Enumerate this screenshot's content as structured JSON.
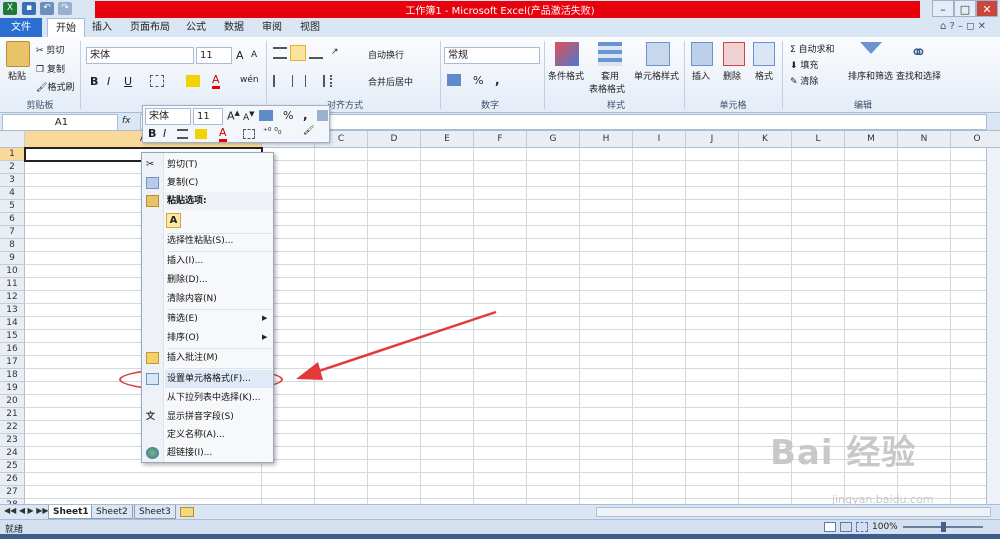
{
  "app": {
    "title": "工作簿1 - Microsoft Excel(产品激活失败)"
  },
  "tabs": {
    "file": "文件",
    "home": "开始",
    "insert": "插入",
    "page_layout": "页面布局",
    "formulas": "公式",
    "data": "数据",
    "review": "审阅",
    "view": "视图"
  },
  "ribbon": {
    "clipboard": {
      "label": "剪贴板",
      "paste": "粘贴",
      "cut": "剪切",
      "copy": "复制",
      "format_painter": "格式刷"
    },
    "font": {
      "label": "字体",
      "name": "宋体",
      "size": "11",
      "bold": "B",
      "italic": "I",
      "underline": "U",
      "grow": "A",
      "shrink": "A",
      "color_letter": "A",
      "phonetic": "wén"
    },
    "alignment": {
      "label": "对齐方式",
      "wrap_text": "自动换行",
      "merge_center": "合并后居中"
    },
    "number": {
      "label": "数字",
      "format": "常规",
      "percent": "%",
      "comma": ","
    },
    "styles": {
      "label": "样式",
      "conditional": "条件格式",
      "table_format_1": "套用",
      "table_format_2": "表格格式",
      "cell_styles": "单元格样式"
    },
    "cells": {
      "label": "单元格",
      "insert": "插入",
      "delete": "删除",
      "format": "格式"
    },
    "editing": {
      "label": "编辑",
      "autosum": "Σ 自动求和",
      "fill": "填充",
      "clear": "清除",
      "sort_filter": "排序和筛选",
      "find_select": "查找和选择"
    }
  },
  "formula_bar": {
    "name_box": "A1",
    "fx": "fx"
  },
  "grid": {
    "columns": [
      "A",
      "B",
      "C",
      "D",
      "E",
      "F",
      "G",
      "H",
      "I",
      "J",
      "K",
      "L",
      "M",
      "N",
      "O"
    ],
    "rows": [
      "1",
      "2",
      "3",
      "4",
      "5",
      "6",
      "7",
      "8",
      "9",
      "10",
      "11",
      "12",
      "13",
      "14",
      "15",
      "16",
      "17",
      "18",
      "19",
      "20",
      "21",
      "22",
      "23",
      "24",
      "25",
      "26",
      "27",
      "28"
    ]
  },
  "mini_toolbar": {
    "font": "宋体",
    "size": "11",
    "percent": "%",
    "comma": ",",
    "bold": "B",
    "italic": "I",
    "font_color": "A"
  },
  "context_menu": {
    "cut": "剪切(T)",
    "copy": "复制(C)",
    "paste_options": "粘贴选项:",
    "paste_value_icon": "A",
    "paste_special": "选择性粘贴(S)...",
    "insert": "插入(I)...",
    "delete": "删除(D)...",
    "clear_contents": "清除内容(N)",
    "filter": "筛选(E)",
    "sort": "排序(O)",
    "insert_comment": "插入批注(M)",
    "format_cells": "设置单元格格式(F)...",
    "pick_from_list": "从下拉列表中选择(K)...",
    "show_phonetic": "显示拼音字段(S)",
    "define_name": "定义名称(A)...",
    "hyperlink": "超链接(I)..."
  },
  "sheets": [
    "Sheet1",
    "Sheet2",
    "Sheet3"
  ],
  "status": {
    "text": "就绪",
    "zoom": "100%"
  },
  "watermark": {
    "brand": "Bai 经验",
    "url": "jingyan.baidu.com"
  },
  "colors": {
    "title_red": "#e8000c",
    "excel_green": "#1f7a36",
    "file_blue": "#2a6fcf",
    "annotation_red": "#e23a3a",
    "grid": "#d4d9e0"
  }
}
